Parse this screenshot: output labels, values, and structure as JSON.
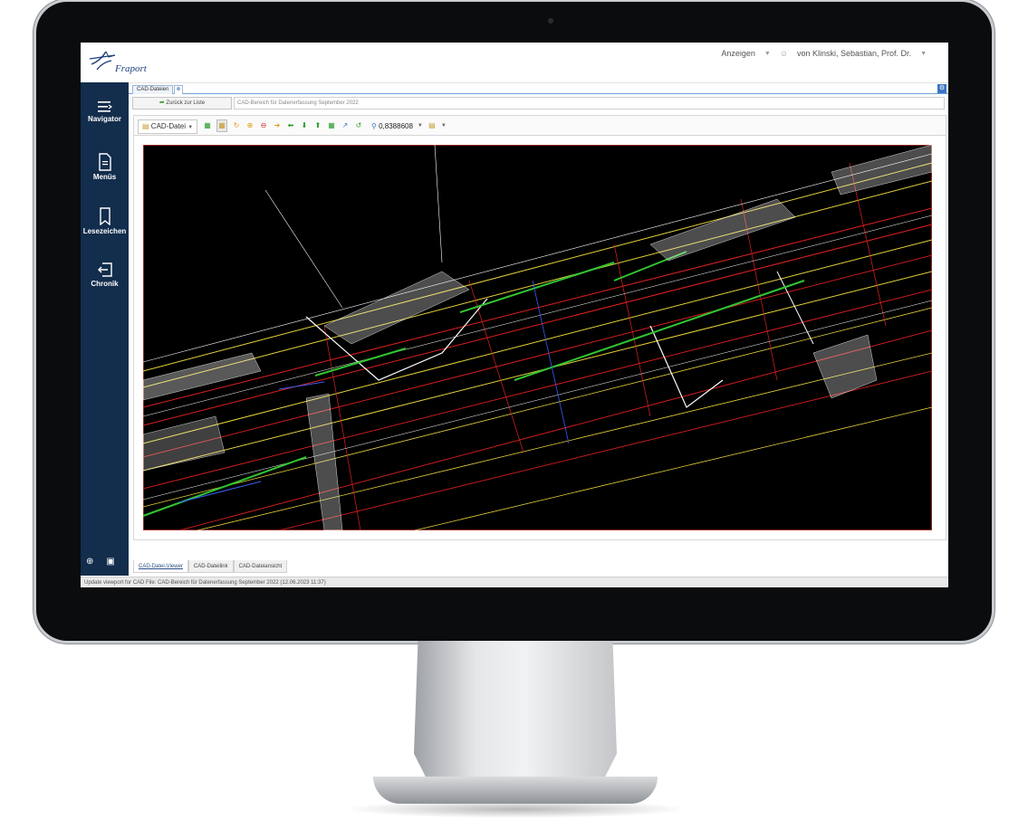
{
  "header": {
    "logo_text": "Fraport",
    "view_menu": "Anzeigen",
    "user": "von Klinski, Sebastian, Prof. Dr."
  },
  "sidebar": {
    "items": [
      {
        "label": "Navigator",
        "icon": "menu-lines-icon"
      },
      {
        "label": "Menüs",
        "icon": "document-icon"
      },
      {
        "label": "Lesezeichen",
        "icon": "bookmark-icon"
      },
      {
        "label": "Chronik",
        "icon": "history-exit-icon"
      }
    ]
  },
  "tabs": {
    "doc_tab": "CAD-Dateien",
    "close_symbol": "⊗"
  },
  "backrow": {
    "back_label": "Zurück zur Liste",
    "path_value": "CAD-Bereich für Datenerfassung September 2022"
  },
  "toolbar": {
    "cad_select": "CAD-Datei",
    "zoom_value": "0,8388608"
  },
  "bottom_tabs": [
    {
      "label": "CAD-Datei-Viewer",
      "active": true
    },
    {
      "label": "CAD-Dateilink",
      "active": false
    },
    {
      "label": "CAD-Dateiansicht",
      "active": false
    }
  ],
  "status": {
    "text": "Update viewport for CAD File: CAD-Bereich für Datenerfassung September 2022 (12.06.2023 11:37)"
  },
  "colors": {
    "sidebar_bg": "#132d4c",
    "cad_bg": "#000000",
    "cad_border": "#c0392b",
    "accent_blue": "#3a75c4"
  }
}
